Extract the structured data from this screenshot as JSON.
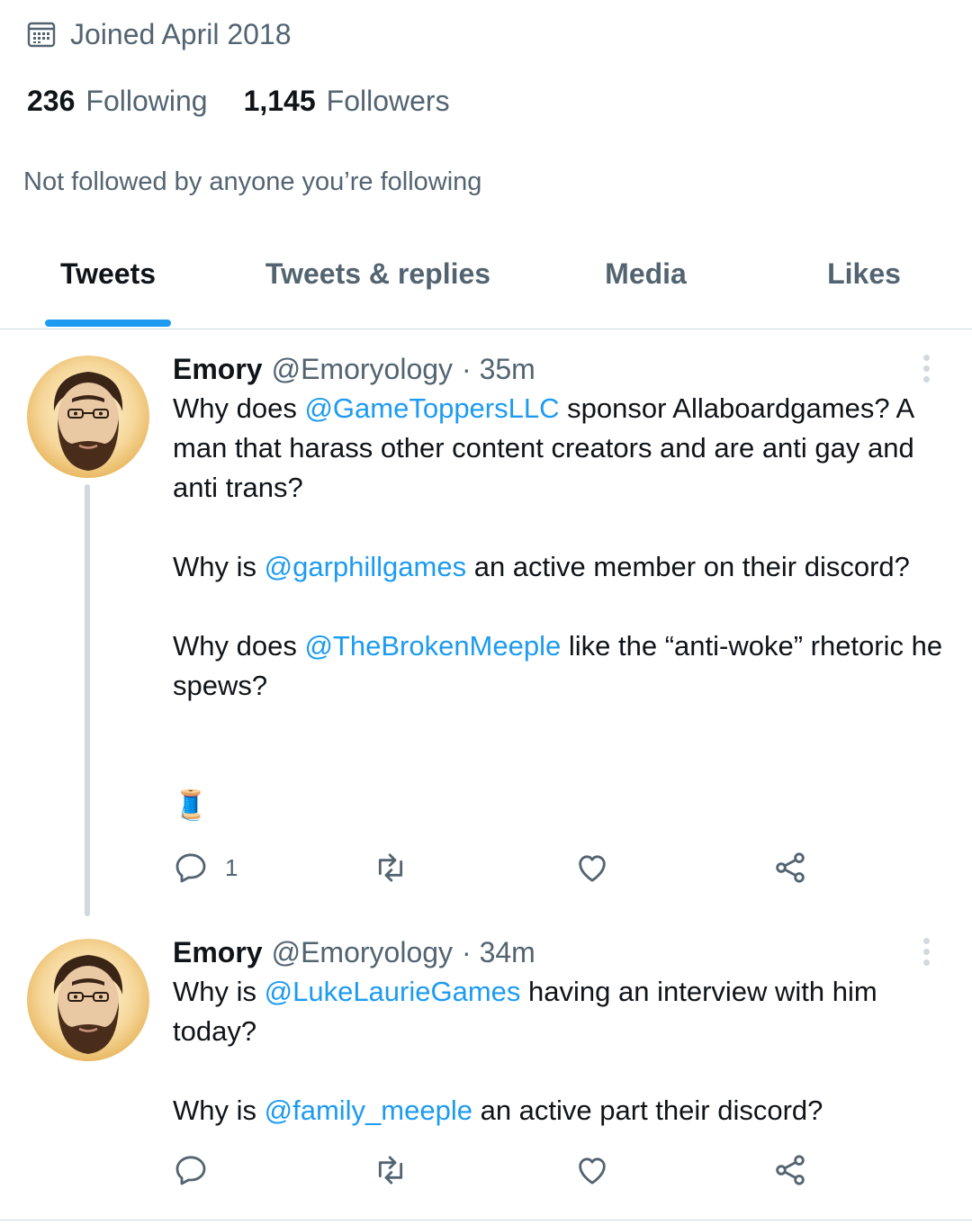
{
  "profile": {
    "joined": "Joined April 2018",
    "following_count": "236",
    "following_label": "Following",
    "followers_count": "1,145",
    "followers_label": "Followers",
    "not_followed": "Not followed by anyone you’re following"
  },
  "tabs": [
    {
      "label": "Tweets",
      "active": true
    },
    {
      "label": "Tweets & replies",
      "active": false
    },
    {
      "label": "Media",
      "active": false
    },
    {
      "label": "Likes",
      "active": false
    }
  ],
  "colors": {
    "accent": "#1d9bf0",
    "secondary_text": "#536471",
    "primary_text": "#0f1419",
    "divider": "#cfd9de"
  },
  "tweets": [
    {
      "name": "Emory",
      "handle": "@Emoryology",
      "time": "· 35m",
      "reply_count": "1",
      "spool_emoji": "🧵",
      "paragraphs": [
        [
          {
            "t": "Why does "
          },
          {
            "t": "@GameToppersLLC",
            "m": true
          },
          {
            "t": " sponsor Allaboardgames? A man that harass other content creators and are anti gay and anti trans?"
          }
        ],
        [
          {
            "t": "Why is "
          },
          {
            "t": "@garphillgames",
            "m": true
          },
          {
            "t": " an active member on their discord?"
          }
        ],
        [
          {
            "t": "Why does "
          },
          {
            "t": "@TheBrokenMeeple",
            "m": true
          },
          {
            "t": " like the “anti-woke” rhetoric he spews?"
          }
        ]
      ]
    },
    {
      "name": "Emory",
      "handle": "@Emoryology",
      "time": "· 34m",
      "reply_count": "",
      "paragraphs": [
        [
          {
            "t": "Why is "
          },
          {
            "t": "@LukeLaurieGames",
            "m": true
          },
          {
            "t": " having an interview with him today?"
          }
        ],
        [
          {
            "t": "Why is "
          },
          {
            "t": "@family_meeple",
            "m": true
          },
          {
            "t": " an active part their discord?"
          }
        ]
      ]
    }
  ],
  "icons": [
    "calendar-icon",
    "more-icon",
    "reply-icon",
    "retweet-icon",
    "like-icon",
    "share-icon",
    "thread-spool-icon"
  ]
}
